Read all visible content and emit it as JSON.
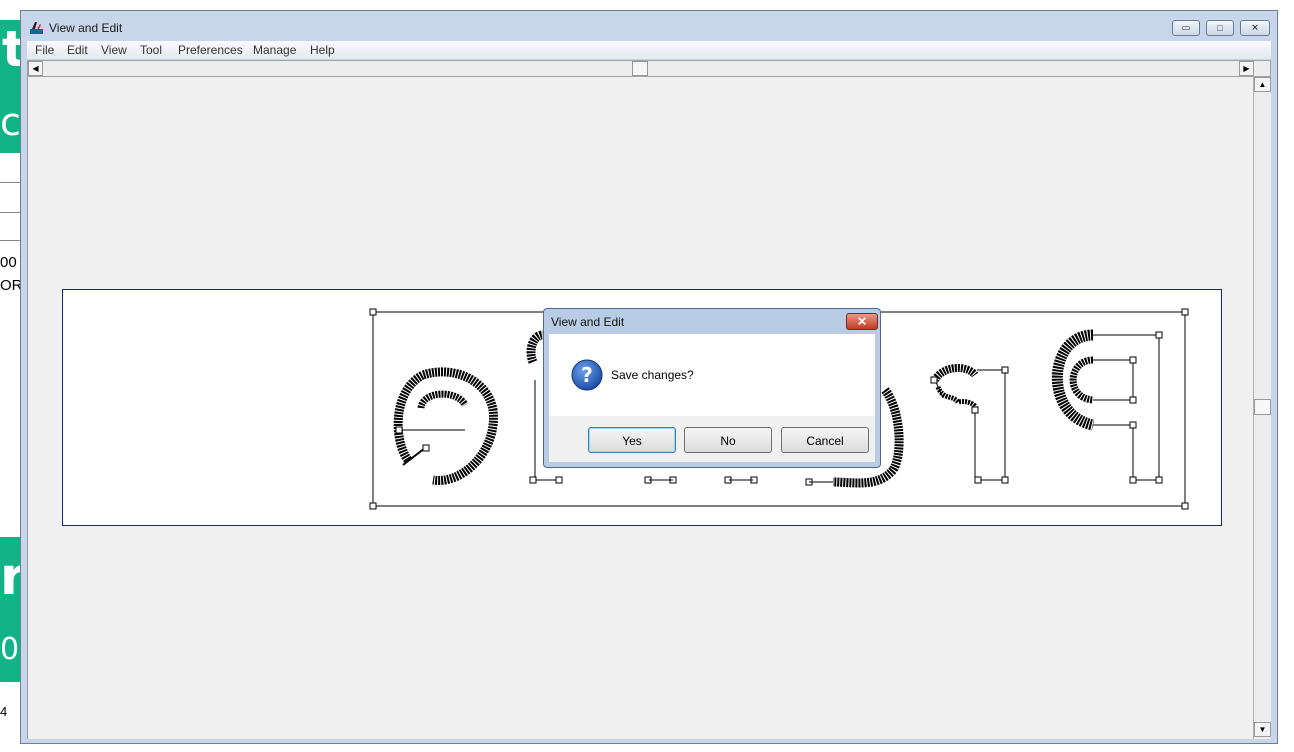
{
  "window": {
    "title": "View and Edit",
    "minimize_glyph": "▭",
    "maximize_glyph": "□",
    "close_glyph": "✕"
  },
  "menu": [
    "File",
    "Edit",
    "View",
    "Tool",
    "Preferences",
    "Manage",
    "Help"
  ],
  "scroll": {
    "left": "◀",
    "right": "▶",
    "up": "▲",
    "down": "▼"
  },
  "background_app": {
    "green_top": "t",
    "green_top2": "c",
    "text1": "00",
    "text2": "OR",
    "green_bottom": "r",
    "green_bottom2": "0",
    "text3": "4"
  },
  "dialog": {
    "title": "View and Edit",
    "close_glyph": "✕",
    "icon": "question-icon",
    "message": "Save changes?",
    "buttons": {
      "yes": "Yes",
      "no": "No",
      "cancel": "Cancel"
    }
  },
  "colors": {
    "accent": "#1b1bb0",
    "green": "#12b487",
    "dialog_icon": "#2359b3"
  }
}
